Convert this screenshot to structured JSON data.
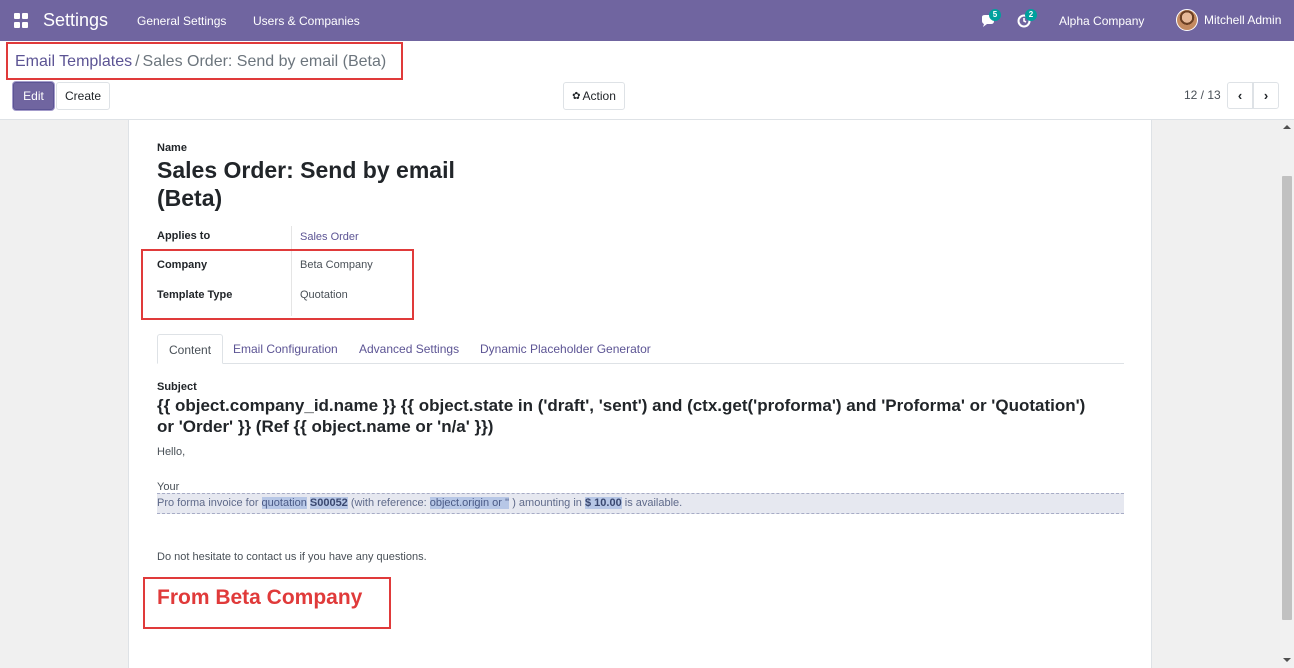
{
  "navbar": {
    "app_title": "Settings",
    "menu_general": "General Settings",
    "menu_users": "Users & Companies",
    "chat_badge": "5",
    "activity_badge": "2",
    "company": "Alpha Company",
    "user": "Mitchell Admin"
  },
  "control_panel": {
    "breadcrumb_parent": "Email Templates",
    "breadcrumb_separator": "/",
    "breadcrumb_current": "Sales Order: Send by email (Beta)",
    "edit_label": "Edit",
    "create_label": "Create",
    "action_label": "Action",
    "pager": "12 / 13"
  },
  "form": {
    "name_caption": "Name",
    "name_line1": "Sales Order: Send by email",
    "name_line2": "(Beta)",
    "fields": {
      "applies_to_label": "Applies to",
      "applies_to_value": "Sales Order",
      "company_label": "Company",
      "company_value": "Beta Company",
      "template_type_label": "Template Type",
      "template_type_value": "Quotation"
    },
    "tabs": [
      "Content",
      "Email Configuration",
      "Advanced Settings",
      "Dynamic Placeholder Generator"
    ],
    "subject_caption": "Subject",
    "subject_line1": "{{ object.company_id.name }} {{ object.state in ('draft', 'sent') and (ctx.get('proforma') and 'Proforma' or 'Quotation')",
    "subject_line2": "or 'Order' }} (Ref {{ object.name or 'n/a' }})",
    "body": {
      "hello": "Hello,",
      "your": "Your",
      "proforma_prefix": "Pro forma invoice for ",
      "proforma_quotation": "quotation",
      "proforma_number": "S00052",
      "proforma_ref_open": "(with reference: ",
      "proforma_ref_value": "object.origin or ''",
      "proforma_ref_close": " ) amounting in ",
      "proforma_amount": "$ 10.00",
      "proforma_suffix": " is available.",
      "contact": "Do not hesitate to contact us if you have any questions.",
      "signature": "From Beta Company"
    }
  },
  "colors": {
    "navbar": "#7065a0",
    "highlight_box": "#e03a3a",
    "link": "#5c5494",
    "badge": "#00a09d"
  },
  "icons": [
    "apps-icon",
    "chat-icon",
    "activity-clock-icon",
    "gear-icon",
    "chevron-left-icon",
    "chevron-right-icon"
  ]
}
